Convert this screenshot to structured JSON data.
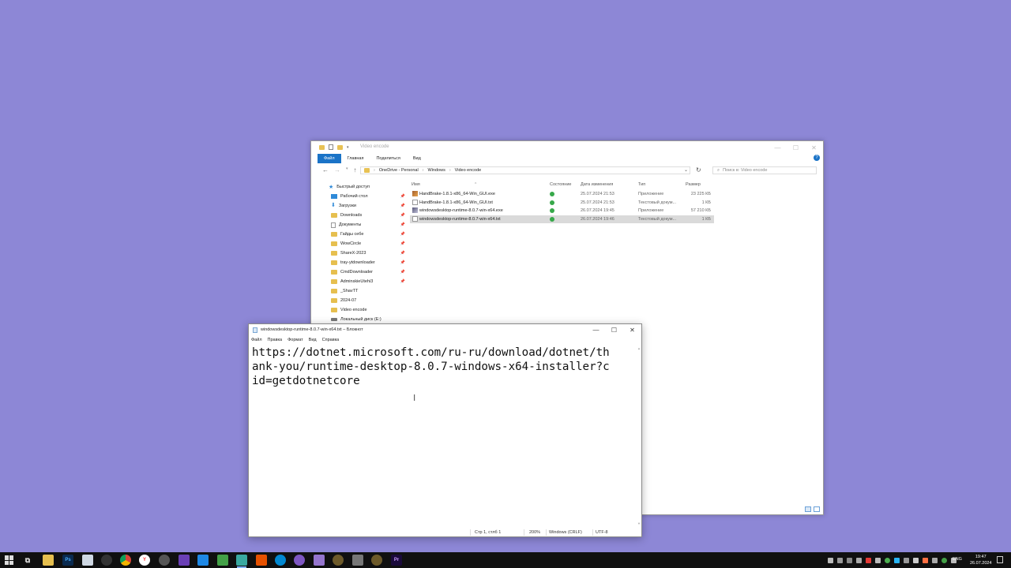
{
  "explorer": {
    "title": "Video encode",
    "ribbon_tabs": [
      "Файл",
      "Главная",
      "Поделиться",
      "Вид"
    ],
    "breadcrumb": [
      "OneDrive - Personal",
      "Windows",
      "Video encode"
    ],
    "search_placeholder": "Поиск в: Video encode",
    "nav_items": [
      {
        "label": "Быстрый доступ",
        "icon": "star-icon",
        "pinned": false
      },
      {
        "label": "Рабочий стол",
        "icon": "desktop-icon",
        "pinned": true
      },
      {
        "label": "Загрузки",
        "icon": "download-icon",
        "pinned": true
      },
      {
        "label": "Downloads",
        "icon": "folder-icon",
        "pinned": true
      },
      {
        "label": "Документы",
        "icon": "documents-icon",
        "pinned": true
      },
      {
        "label": "Гайды себе",
        "icon": "folder-icon",
        "pinned": true
      },
      {
        "label": "WowCircle",
        "icon": "folder-icon",
        "pinned": true
      },
      {
        "label": "ShareX-2023",
        "icon": "folder-icon",
        "pinned": true
      },
      {
        "label": "tray-ytdownloader",
        "icon": "folder-icon",
        "pinned": true
      },
      {
        "label": "CmdDownloader",
        "icon": "folder-icon",
        "pinned": true
      },
      {
        "label": "AdminskieUtehi3",
        "icon": "folder-icon",
        "pinned": true
      },
      {
        "label": "_ShavTT",
        "icon": "folder-icon",
        "pinned": false
      },
      {
        "label": "2024-07",
        "icon": "folder-icon",
        "pinned": false
      },
      {
        "label": "Video encode",
        "icon": "folder-icon",
        "pinned": false
      },
      {
        "label": "Локальный диск (E:)",
        "icon": "drive-icon",
        "pinned": false
      }
    ],
    "columns": {
      "name": "Имя",
      "status": "Состояние",
      "date": "Дата изменения",
      "type": "Тип",
      "size": "Размер"
    },
    "files": [
      {
        "name": "HandBrake-1.8.1-x86_64-Win_GUI.exe",
        "date": "25.07.2024 21:53",
        "type": "Приложение",
        "size": "23 225 КБ",
        "icon": "exe"
      },
      {
        "name": "HandBrake-1.8.1-x86_64-Win_GUI.txt",
        "date": "25.07.2024 21:53",
        "type": "Текстовый докум...",
        "size": "1 КБ",
        "icon": "txt"
      },
      {
        "name": "windowsdesktop-runtime-8.0.7-win-x64.exe",
        "date": "26.07.2024 19:45",
        "type": "Приложение",
        "size": "57 210 КБ",
        "icon": "exe"
      },
      {
        "name": "windowsdesktop-runtime-8.0.7-win-x64.txt",
        "date": "26.07.2024 19:46",
        "type": "Текстовый докум...",
        "size": "1 КБ",
        "icon": "txt",
        "selected": true
      }
    ]
  },
  "notepad": {
    "title": "windowsdesktop-runtime-8.0.7-win-x64.txt – Блокнот",
    "menu": [
      "Файл",
      "Правка",
      "Формат",
      "Вид",
      "Справка"
    ],
    "content": "https://dotnet.microsoft.com/ru-ru/download/dotnet/thank-you/runtime-desktop-8.0.7-windows-x64-installer?cid=getdotnetcore",
    "status": {
      "position": "Стр 1, стлб 1",
      "zoom": "200%",
      "line_ending": "Windows (CRLF)",
      "encoding": "UTF-8"
    }
  },
  "taskbar": {
    "lang": "ENG",
    "time": "19:47",
    "date": "26.07.2024"
  }
}
